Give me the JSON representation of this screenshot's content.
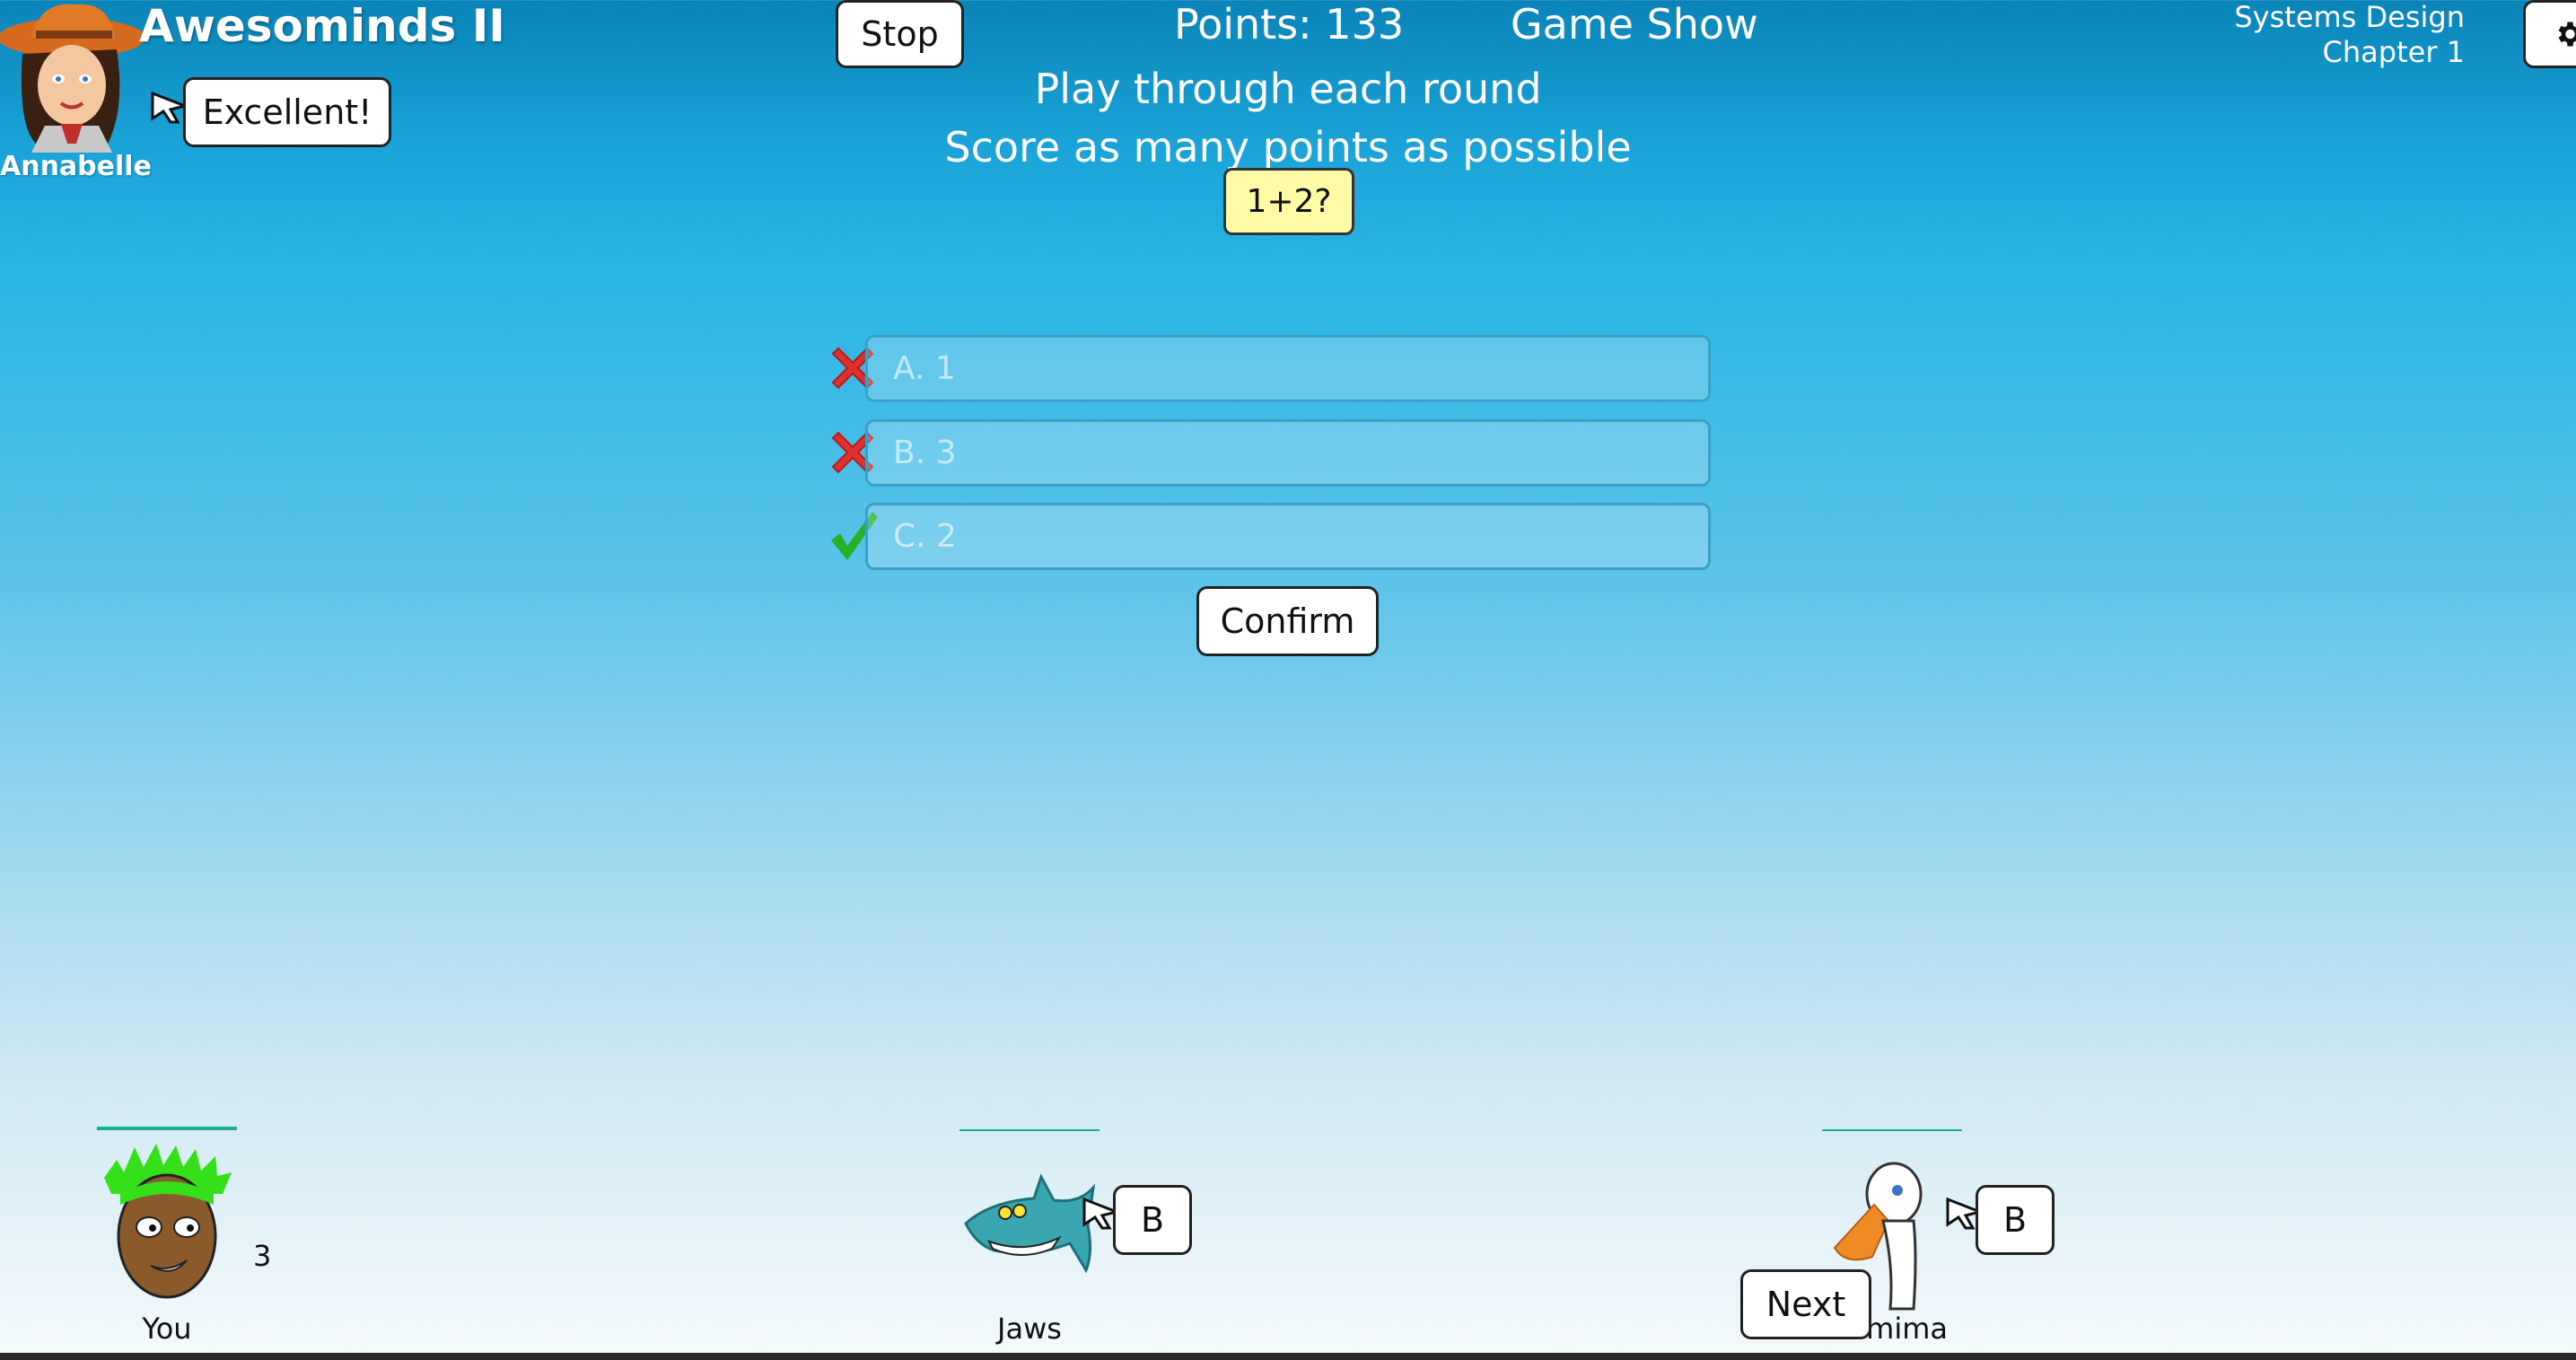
{
  "app": {
    "title": "Awesominds II",
    "stop_label": "Stop",
    "settings_icon": "gear-icon"
  },
  "status": {
    "points_text": "Points: 133",
    "mode_text": "Game Show"
  },
  "course": {
    "line1": "Systems Design",
    "line2": "Chapter 1"
  },
  "host": {
    "name": "Annabelle",
    "speech": "Excellent!"
  },
  "instructions": {
    "line1": "Play through each round",
    "line2": "Score as many points as possible"
  },
  "question": {
    "text": "1+2?"
  },
  "answers": [
    {
      "label": "A. 1",
      "mark": "wrong"
    },
    {
      "label": "B. 3",
      "mark": "wrong"
    },
    {
      "label": "C. 2",
      "mark": "correct"
    }
  ],
  "confirm_label": "Confirm",
  "next_label": "Next",
  "players": [
    {
      "name": "You",
      "score": "3"
    },
    {
      "name": "Jaws",
      "bubble": "B"
    },
    {
      "name": "mima",
      "bubble": "B"
    }
  ],
  "colors": {
    "wrong": "#e0302f",
    "correct": "#22b32a",
    "question_bg": "#fefaa6",
    "ground_line": "#19b08a"
  }
}
